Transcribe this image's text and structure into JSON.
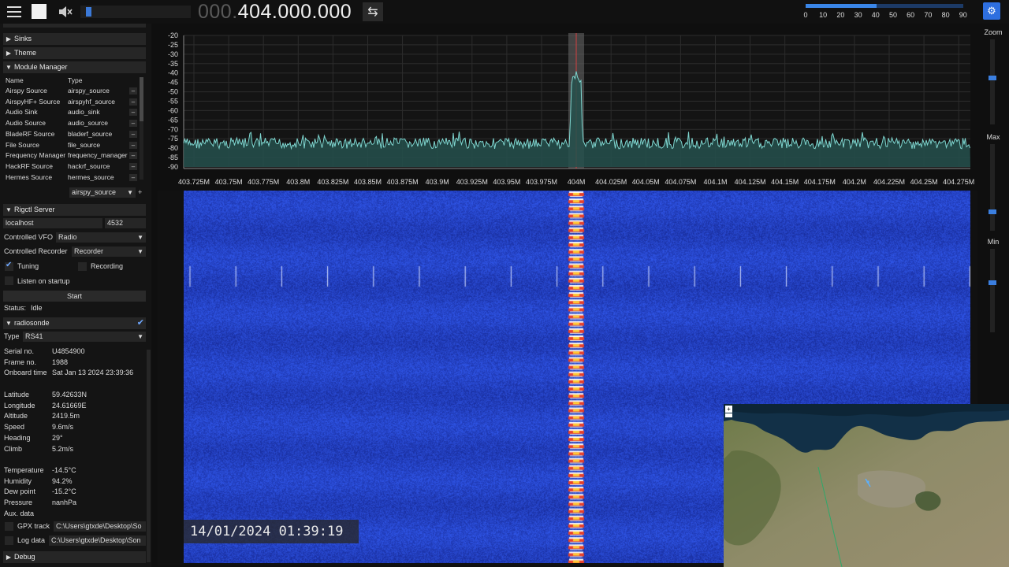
{
  "topbar": {
    "freq_dim": "000.",
    "freq_bright": "404.000.000",
    "snr_ticks": [
      "0",
      "10",
      "20",
      "30",
      "40",
      "50",
      "60",
      "70",
      "80",
      "90"
    ],
    "snr_level": 0.45,
    "volume_level": 0.05,
    "colors": {
      "accent": "#3a86e8"
    }
  },
  "sidebar": {
    "sections": {
      "sinks": "Sinks",
      "theme": "Theme",
      "module_manager": "Module Manager",
      "rigctl": "Rigctl Server",
      "radiosonde": "radiosonde",
      "debug": "Debug"
    },
    "module_manager": {
      "col_name": "Name",
      "col_type": "Type",
      "rows": [
        {
          "name": "Airspy Source",
          "type": "airspy_source"
        },
        {
          "name": "AirspyHF+ Source",
          "type": "airspyhf_source"
        },
        {
          "name": "Audio Sink",
          "type": "audio_sink"
        },
        {
          "name": "Audio Source",
          "type": "audio_source"
        },
        {
          "name": "BladeRF Source",
          "type": "bladerf_source"
        },
        {
          "name": "File Source",
          "type": "file_source"
        },
        {
          "name": "Frequency Manager",
          "type": "frequency_manager"
        },
        {
          "name": "HackRF Source",
          "type": "hackrf_source"
        },
        {
          "name": "Hermes Source",
          "type": "hermes_source"
        }
      ],
      "delete_glyph": "–",
      "new_module_type": "airspy_source",
      "add_glyph": "+"
    },
    "rigctl": {
      "host": "localhost",
      "port": "4532",
      "controlled_vfo_label": "Controlled VFO",
      "controlled_vfo_value": "Radio",
      "controlled_recorder_label": "Controlled Recorder",
      "controlled_recorder_value": "Recorder",
      "tuning_label": "Tuning",
      "recording_label": "Recording",
      "listen_label": "Listen on startup",
      "start_label": "Start",
      "status_label": "Status:",
      "status_value": "Idle"
    },
    "radiosonde": {
      "type_label": "Type",
      "type_value": "RS41",
      "info": [
        {
          "k": "Serial no.",
          "v": "U4854900"
        },
        {
          "k": "Frame no.",
          "v": "1988"
        },
        {
          "k": "Onboard time",
          "v": "Sat Jan 13 2024 23:39:36"
        }
      ],
      "position": [
        {
          "k": "Latitude",
          "v": "59.42633N"
        },
        {
          "k": "Longitude",
          "v": "24.61669E"
        },
        {
          "k": "Altitude",
          "v": "2419.5m"
        },
        {
          "k": "Speed",
          "v": "9.6m/s"
        },
        {
          "k": "Heading",
          "v": "29°"
        },
        {
          "k": "Climb",
          "v": "5.2m/s"
        }
      ],
      "ptu": [
        {
          "k": "Temperature",
          "v": "-14.5°C"
        },
        {
          "k": "Humidity",
          "v": "94.2%"
        },
        {
          "k": "Dew point",
          "v": "-15.2°C"
        },
        {
          "k": "Pressure",
          "v": "nanhPa"
        },
        {
          "k": "Aux. data",
          "v": ""
        }
      ],
      "gpx_label": "GPX track",
      "gpx_path": "C:\\Users\\gtxde\\Desktop\\So",
      "log_label": "Log data",
      "log_path": "C:\\Users\\gtxde\\Desktop\\Son"
    }
  },
  "spectrum": {
    "y_ticks": [
      "-20",
      "-25",
      "-30",
      "-35",
      "-40",
      "-45",
      "-50",
      "-55",
      "-60",
      "-65",
      "-70",
      "-75",
      "-80",
      "-85",
      "-90"
    ],
    "x_ticks": [
      "403.725M",
      "403.75M",
      "403.775M",
      "403.8M",
      "403.825M",
      "403.85M",
      "403.875M",
      "403.9M",
      "403.925M",
      "403.95M",
      "403.975M",
      "404M",
      "404.025M",
      "404.05M",
      "404.075M",
      "404.1M",
      "404.125M",
      "404.15M",
      "404.175M",
      "404.2M",
      "404.225M",
      "404.25M",
      "404.275M"
    ],
    "colors": {
      "trace": "#7fd6d0",
      "fill": "#24504c",
      "vfo": "#d04040"
    }
  },
  "waterfall": {
    "timestamp": "14/01/2024 01:39:19"
  },
  "right_sliders": {
    "zoom_label": "Zoom",
    "max_label": "Max",
    "min_label": "Min"
  }
}
